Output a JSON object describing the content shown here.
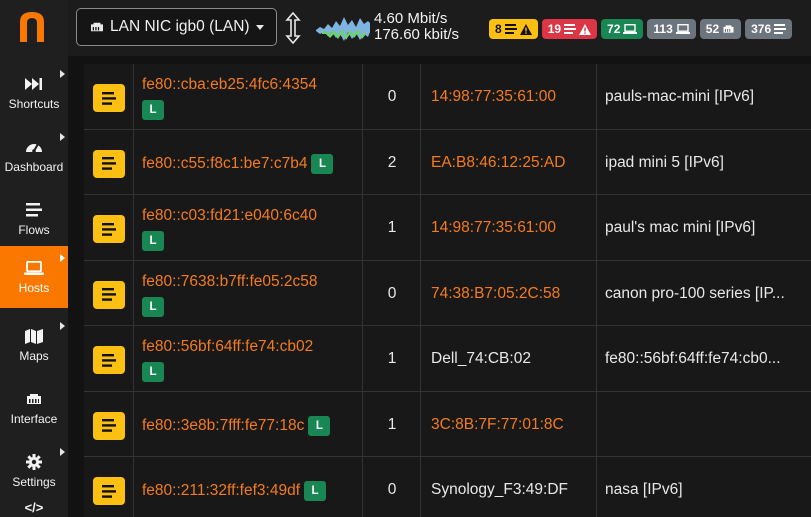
{
  "colors": {
    "accent": "#fb7800",
    "link": "#f37b1d",
    "warning": "#fbc012",
    "danger": "#dc3545",
    "success": "#198754",
    "neutral": "#6c757d"
  },
  "sidebar": {
    "logo": "n-logo",
    "items": [
      {
        "label": "Shortcuts",
        "icon": "fast-forward-icon",
        "has_submenu": true,
        "active": false
      },
      {
        "label": "Dashboard",
        "icon": "gauge-icon",
        "has_submenu": true,
        "active": false
      },
      {
        "label": "Flows",
        "icon": "stream-icon",
        "has_submenu": false,
        "active": false
      },
      {
        "label": "Hosts",
        "icon": "laptop-icon",
        "has_submenu": true,
        "active": true
      },
      {
        "label": "Maps",
        "icon": "map-icon",
        "has_submenu": true,
        "active": false
      },
      {
        "label": "Interface",
        "icon": "ethernet-icon",
        "has_submenu": false,
        "active": false
      },
      {
        "label": "Settings",
        "icon": "cog-icon",
        "has_submenu": true,
        "active": false
      }
    ]
  },
  "topbar": {
    "interface_select": "LAN NIC igb0 (LAN)",
    "throughput_up": "4.60 Mbit/s",
    "throughput_down": "176.60 kbit/s",
    "badges": [
      {
        "value": "8",
        "icon": "flows-warning-icon",
        "color": "yellow"
      },
      {
        "value": "19",
        "icon": "flows-danger-icon",
        "color": "red"
      },
      {
        "value": "72",
        "icon": "local-hosts-icon",
        "color": "green"
      },
      {
        "value": "113",
        "icon": "remote-hosts-icon",
        "color": "gray"
      },
      {
        "value": "52",
        "icon": "devices-icon",
        "color": "gray"
      },
      {
        "value": "376",
        "icon": "flows-icon",
        "color": "gray"
      }
    ]
  },
  "hosts_table": {
    "rows": [
      {
        "ip": "fe80::cba:eb25:4fc6:4354",
        "local_badge": "L",
        "badge_inline": false,
        "count": "0",
        "mac": "14:98:77:35:61:00",
        "mac_link": true,
        "name": "pauls-mac-mini [IPv6]"
      },
      {
        "ip": "fe80::c55:f8c1:be7:c7b4",
        "local_badge": "L",
        "badge_inline": true,
        "count": "2",
        "mac": "EA:B8:46:12:25:AD",
        "mac_link": true,
        "name": "ipad mini 5 [IPv6]"
      },
      {
        "ip": "fe80::c03:fd21:e040:6c40",
        "local_badge": "L",
        "badge_inline": false,
        "count": "1",
        "mac": "14:98:77:35:61:00",
        "mac_link": true,
        "name": "paul's mac mini [IPv6]"
      },
      {
        "ip": "fe80::7638:b7ff:fe05:2c58",
        "local_badge": "L",
        "badge_inline": false,
        "count": "0",
        "mac": "74:38:B7:05:2C:58",
        "mac_link": true,
        "name": "canon pro-100 series [IP..."
      },
      {
        "ip": "fe80::56bf:64ff:fe74:cb02",
        "local_badge": "L",
        "badge_inline": false,
        "count": "1",
        "mac": "Dell_74:CB:02",
        "mac_link": false,
        "name": "fe80::56bf:64ff:fe74:cb0..."
      },
      {
        "ip": "fe80::3e8b:7fff:fe77:18c",
        "local_badge": "L",
        "badge_inline": true,
        "count": "1",
        "mac": "3C:8B:7F:77:01:8C",
        "mac_link": true,
        "name": ""
      },
      {
        "ip": "fe80::211:32ff:fef3:49df",
        "local_badge": "L",
        "badge_inline": true,
        "count": "0",
        "mac": "Synology_F3:49:DF",
        "mac_link": false,
        "name": "nasa [IPv6]"
      }
    ]
  }
}
